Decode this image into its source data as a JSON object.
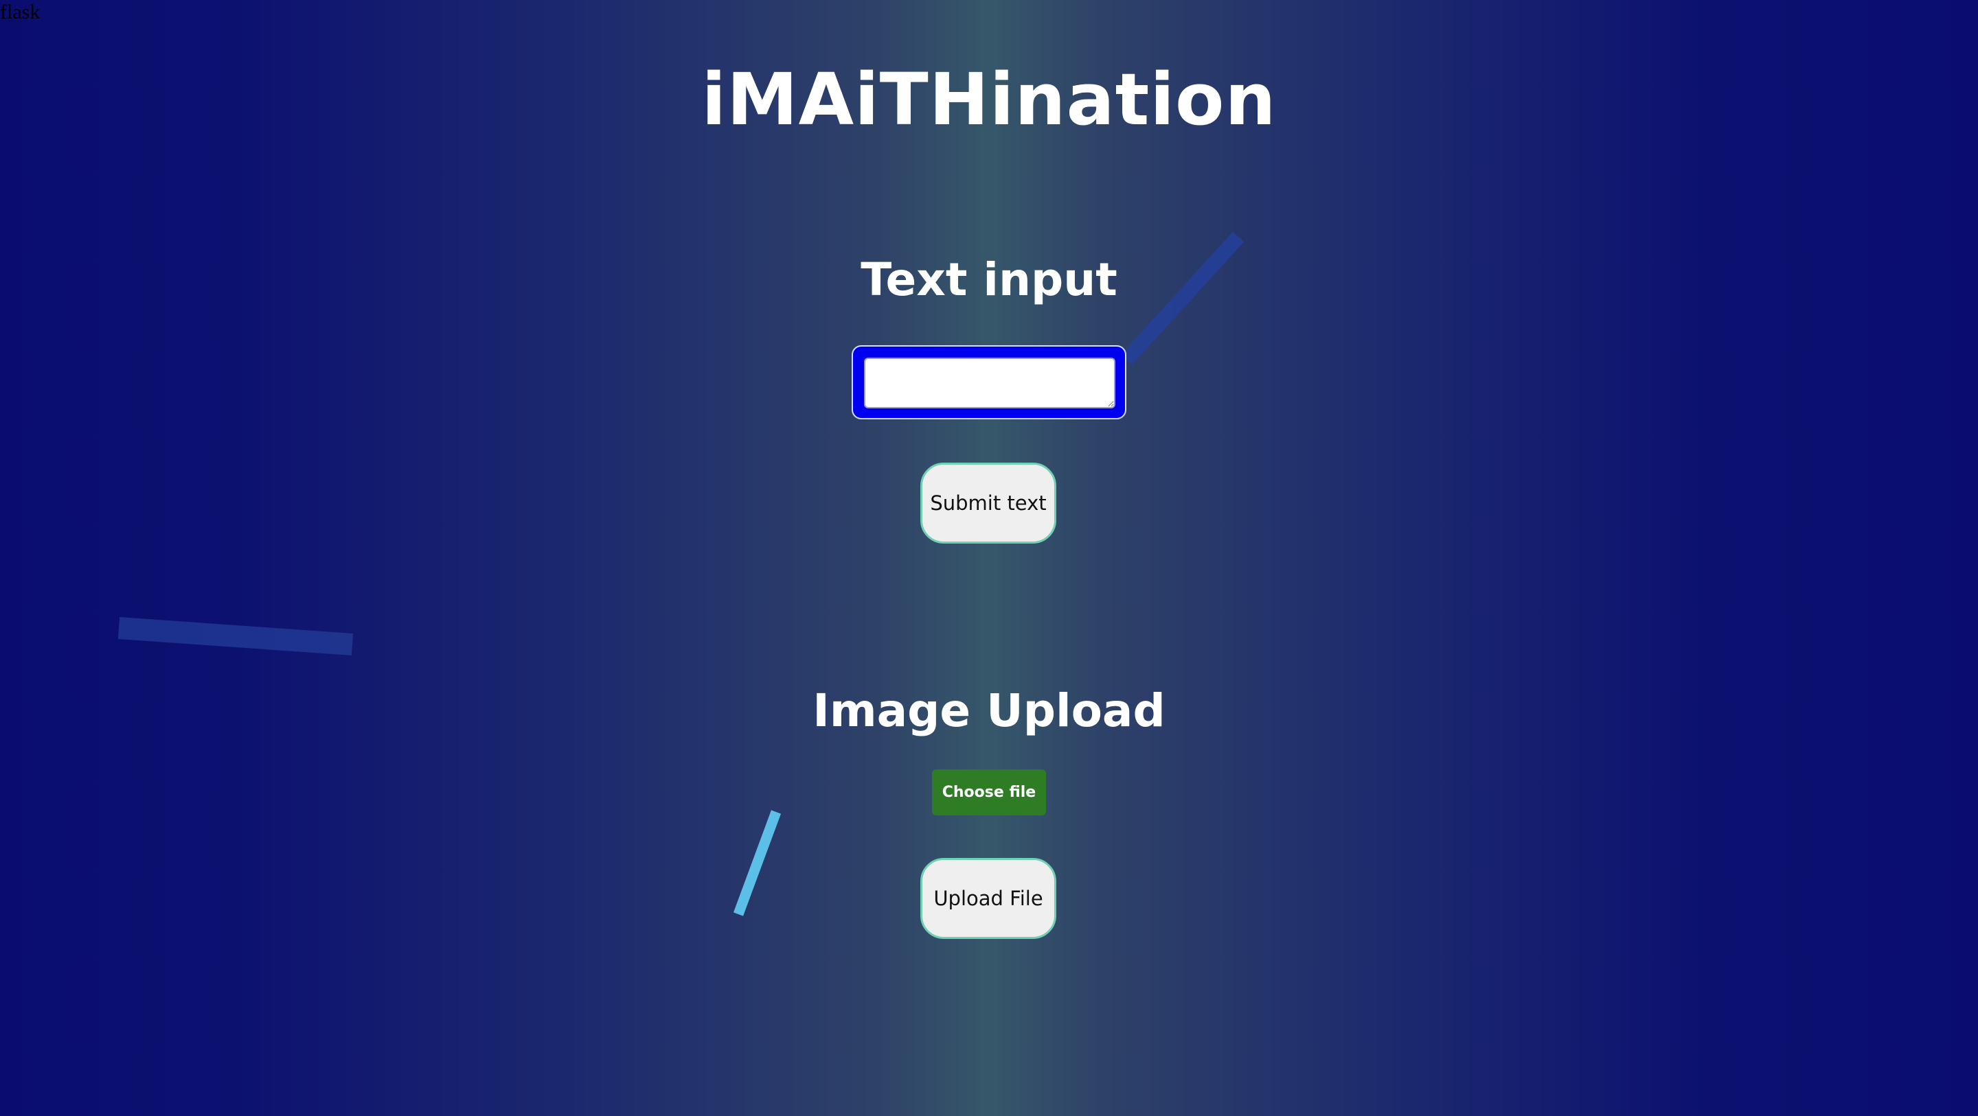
{
  "corner_label": "flask",
  "title": "iMAiTHination",
  "text_section": {
    "heading": "Text input",
    "textarea_value": "",
    "submit_label": "Submit text"
  },
  "image_section": {
    "heading": "Image Upload",
    "choose_file_label": "Choose file",
    "upload_label": "Upload File"
  },
  "colors": {
    "background_edge": "#0a0d6e",
    "background_center": "#36576a",
    "textarea_frame": "#0000f0",
    "choose_file_button": "#2e7d24",
    "button_border": "#6fd0b2",
    "button_fill": "#efefef",
    "streak_dark": "#24409a",
    "streak_light": "#5bbfe8"
  }
}
